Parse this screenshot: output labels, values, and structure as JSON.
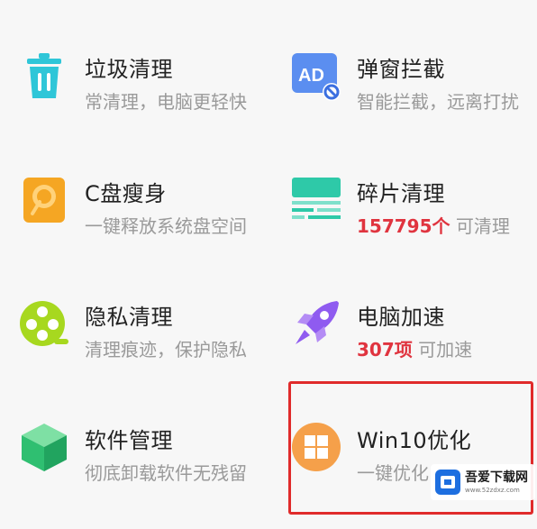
{
  "tiles": [
    {
      "title": "垃圾清理",
      "subtitle": "常清理，电脑更轻快",
      "icon": "trash-can-icon"
    },
    {
      "title": "弹窗拦截",
      "subtitle": "智能拦截，远离打扰",
      "icon": "ad-block-icon",
      "icon_text": "AD"
    },
    {
      "title": "C盘瘦身",
      "subtitle": "一键释放系统盘空间",
      "icon": "disk-slim-icon"
    },
    {
      "title": "碎片清理",
      "count": "157795个",
      "subtitle_suffix": " 可清理",
      "icon": "fragment-icon"
    },
    {
      "title": "隐私清理",
      "subtitle": "清理痕迹，保护隐私",
      "icon": "privacy-film-icon"
    },
    {
      "title": "电脑加速",
      "count": "307项",
      "subtitle_suffix": " 可加速",
      "icon": "rocket-icon"
    },
    {
      "title": "软件管理",
      "subtitle": "彻底卸载软件无残留",
      "icon": "software-box-icon"
    },
    {
      "title": "Win10优化",
      "subtitle": "一键优化",
      "icon": "windows-icon"
    }
  ],
  "watermark": {
    "text": "吾爱下载网",
    "url": "www.52zdxz.com"
  },
  "colors": {
    "highlight": "#e02b2b",
    "count": "#e0343f",
    "subtitle": "#9a9a9a"
  }
}
